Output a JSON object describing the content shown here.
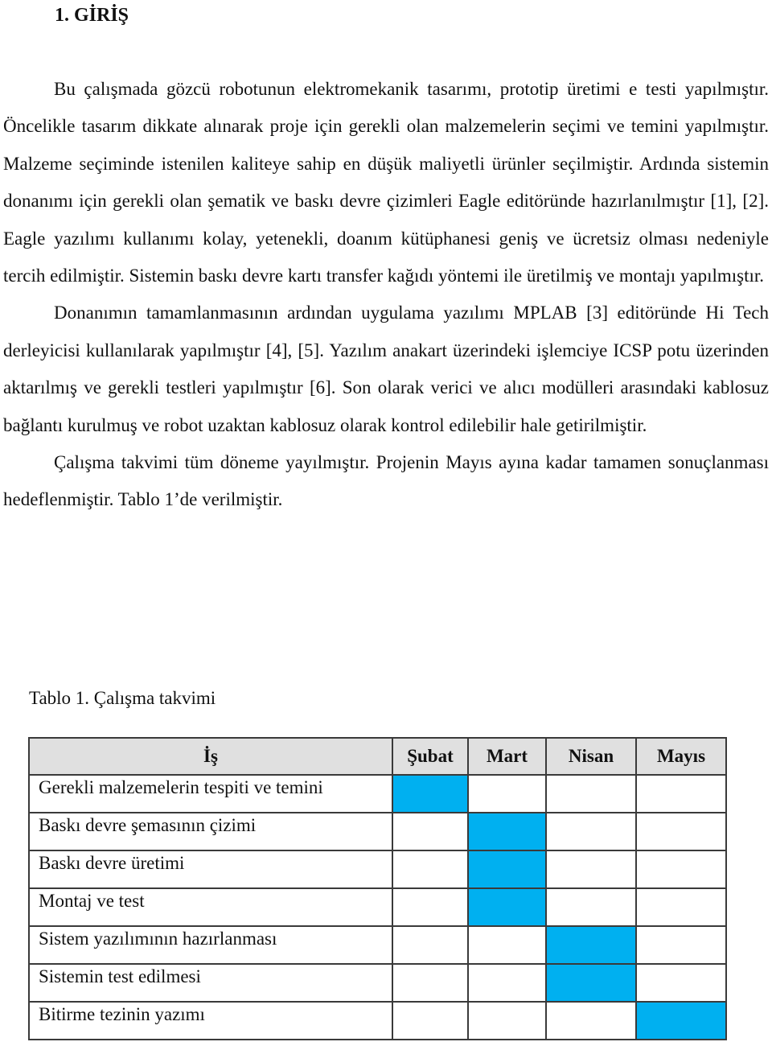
{
  "document": {
    "heading": "1. GİRİŞ",
    "paragraphs": [
      "Bu çalışmada gözcü robotunun elektromekanik tasarımı, prototip üretimi e testi yapılmıştır. Öncelikle tasarım dikkate alınarak proje için gerekli olan malzemelerin seçimi ve temini yapılmıştır. Malzeme seçiminde istenilen kaliteye sahip en düşük maliyetli ürünler seçilmiştir. Ardında sistemin donanımı için gerekli olan şematik ve baskı devre çizimleri Eagle editöründe hazırlanılmıştır [1], [2]. Eagle yazılımı kullanımı kolay, yetenekli, doanım kütüphanesi geniş ve ücretsiz olması nedeniyle tercih edilmiştir. Sistemin baskı devre kartı transfer kağıdı yöntemi ile üretilmiş ve montajı yapılmıştır.",
      "Donanımın tamamlanmasının ardından uygulama yazılımı MPLAB [3] editöründe Hi Tech derleyicisi kullanılarak yapılmıştır [4], [5]. Yazılım anakart üzerindeki işlemciye ICSP potu üzerinden aktarılmış ve gerekli testleri yapılmıştır [6]. Son olarak verici ve alıcı modülleri arasındaki kablosuz bağlantı kurulmuş ve robot uzaktan kablosuz olarak kontrol edilebilir hale getirilmiştir.",
      "Çalışma takvimi tüm döneme yayılmıştır. Projenin Mayıs ayına kadar tamamen sonuçlanması hedeflenmiştir. Tablo 1’de verilmiştir."
    ],
    "table_caption": "Tablo 1. Çalışma takvimi"
  },
  "schedule_table": {
    "fill_color": "#00b0f0",
    "header_color": "#e0e0e0",
    "headers": [
      "İş",
      "Şubat",
      "Mart",
      "Nisan",
      "Mayıs"
    ],
    "rows": [
      {
        "task": "Gerekli malzemelerin tespiti ve temini",
        "months": [
          true,
          false,
          false,
          false
        ]
      },
      {
        "task": "Baskı devre şemasının çizimi",
        "months": [
          false,
          true,
          false,
          false
        ]
      },
      {
        "task": "Baskı devre üretimi",
        "months": [
          false,
          true,
          false,
          false
        ]
      },
      {
        "task": "Montaj ve test",
        "months": [
          false,
          true,
          false,
          false
        ]
      },
      {
        "task": "Sistem yazılımının hazırlanması",
        "months": [
          false,
          false,
          true,
          false
        ]
      },
      {
        "task": "Sistemin test edilmesi",
        "months": [
          false,
          false,
          true,
          false
        ]
      },
      {
        "task": "Bitirme tezinin yazımı",
        "months": [
          false,
          false,
          false,
          true
        ]
      }
    ]
  }
}
